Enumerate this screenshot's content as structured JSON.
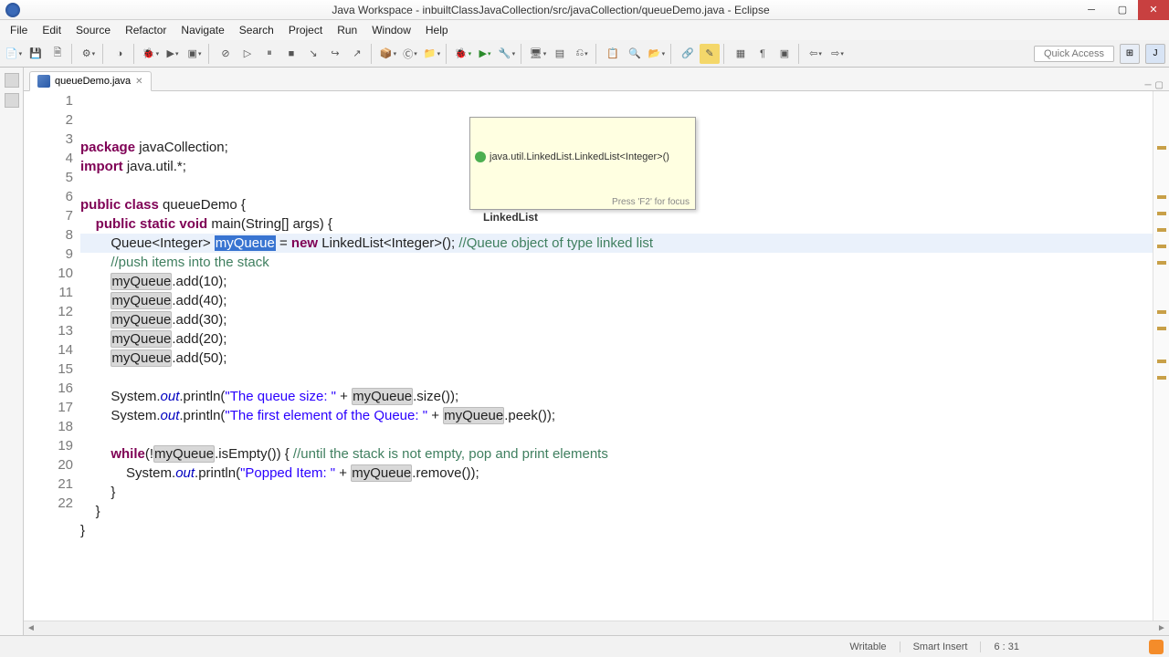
{
  "window": {
    "title": "Java Workspace - inbuiltClassJavaCollection/src/javaCollection/queueDemo.java - Eclipse"
  },
  "menu": [
    "File",
    "Edit",
    "Source",
    "Refactor",
    "Navigate",
    "Search",
    "Project",
    "Run",
    "Window",
    "Help"
  ],
  "toolbar": {
    "quick_access": "Quick Access"
  },
  "tab": {
    "label": "queueDemo.java"
  },
  "hover": {
    "header": "java.util.LinkedList.LinkedList<Integer>()",
    "body": "LinkedList",
    "footer": "Press 'F2' for focus"
  },
  "code": {
    "lines": [
      {
        "n": 1,
        "html": "<span class='kw'>package</span> javaCollection;"
      },
      {
        "n": 2,
        "html": "<span class='kw'>import</span> java.util.*;"
      },
      {
        "n": 3,
        "html": ""
      },
      {
        "n": 4,
        "html": "<span class='kw'>public class</span> queueDemo {"
      },
      {
        "n": 5,
        "html": "    <span class='kw'>public static void</span> main(String[] args) {"
      },
      {
        "n": 6,
        "hl": true,
        "html": "        Queue&lt;Integer&gt; <span class='sel'>myQueue</span> = <span class='kw'>new</span> LinkedList&lt;Integer&gt;(); <span class='cmt'>//Queue object of type linked list</span>"
      },
      {
        "n": 7,
        "html": "        <span class='cmt'>//push items into the stack</span>"
      },
      {
        "n": 8,
        "html": "        <span class='occ'>myQueue</span>.add(10);"
      },
      {
        "n": 9,
        "html": "        <span class='occ'>myQueue</span>.add(40);"
      },
      {
        "n": 10,
        "html": "        <span class='occ'>myQueue</span>.add(30);"
      },
      {
        "n": 11,
        "html": "        <span class='occ'>myQueue</span>.add(20);"
      },
      {
        "n": 12,
        "html": "        <span class='occ'>myQueue</span>.add(50);"
      },
      {
        "n": 13,
        "html": ""
      },
      {
        "n": 14,
        "html": "        System.<span class='stat'>out</span>.println(<span class='str'>\"The queue size: \"</span> + <span class='occ'>myQueue</span>.size());"
      },
      {
        "n": 15,
        "html": "        System.<span class='stat'>out</span>.println(<span class='str'>\"The first element of the Queue: \"</span> + <span class='occ'>myQueue</span>.peek());"
      },
      {
        "n": 16,
        "html": ""
      },
      {
        "n": 17,
        "html": "        <span class='kw'>while</span>(!<span class='occ'>myQueue</span>.isEmpty()) { <span class='cmt'>//until the stack is not empty, pop and print elements</span>"
      },
      {
        "n": 18,
        "html": "            System.<span class='stat'>out</span>.println(<span class='str'>\"Popped Item: \"</span> + <span class='occ'>myQueue</span>.remove());"
      },
      {
        "n": 19,
        "html": "        }"
      },
      {
        "n": 20,
        "html": "    }"
      },
      {
        "n": 21,
        "html": "}"
      },
      {
        "n": 22,
        "html": ""
      }
    ]
  },
  "status": {
    "writable": "Writable",
    "insert": "Smart Insert",
    "pos": "6 : 31"
  }
}
